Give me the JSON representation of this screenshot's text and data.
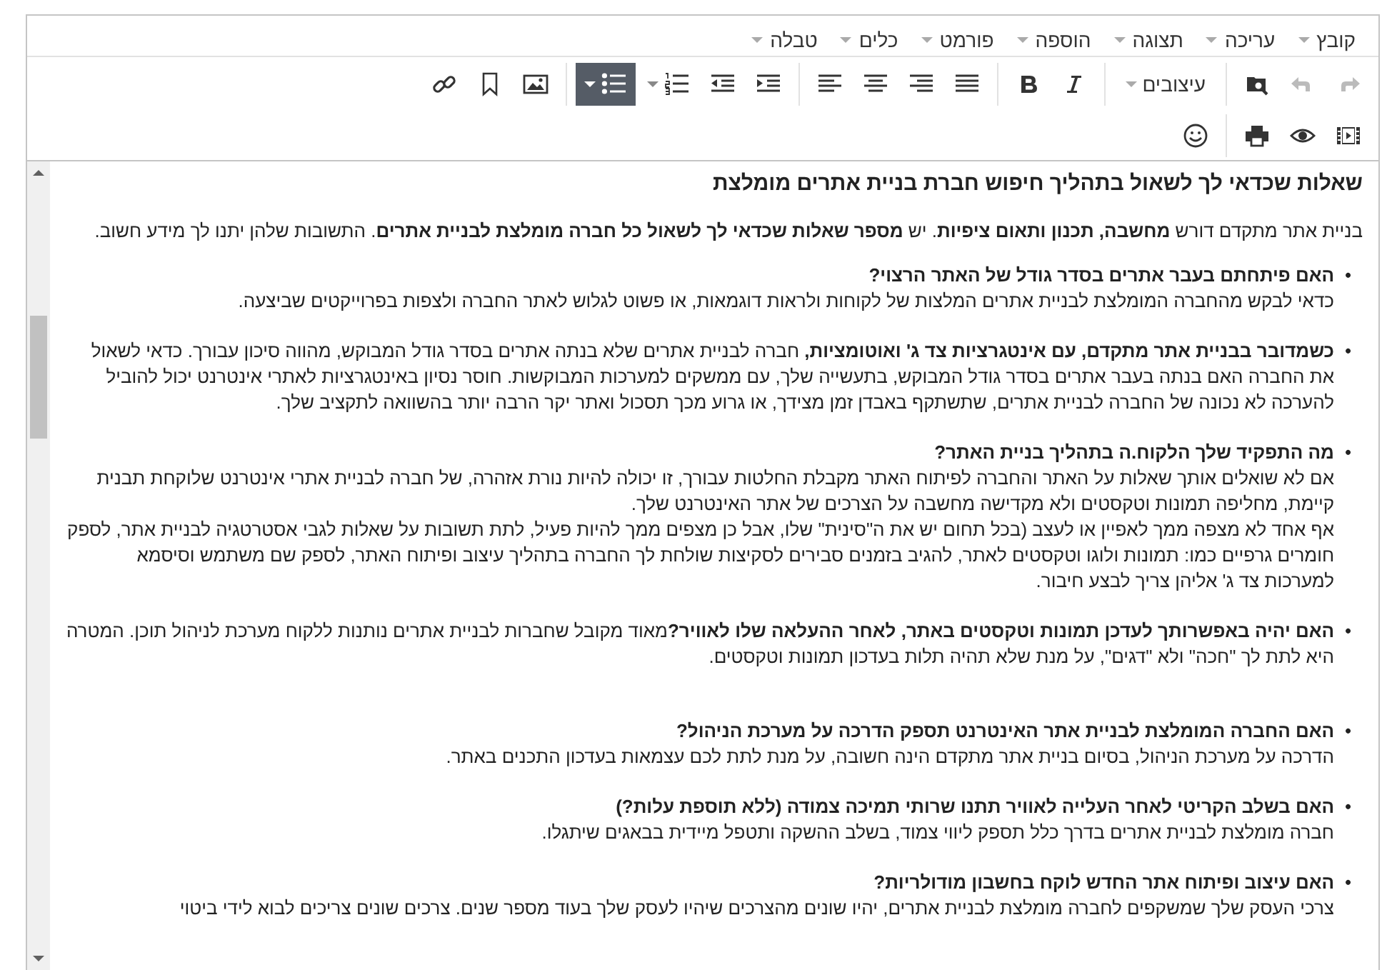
{
  "menubar": [
    {
      "label": "קובץ"
    },
    {
      "label": "עריכה"
    },
    {
      "label": "תצוגה"
    },
    {
      "label": "הוספה"
    },
    {
      "label": "פורמט"
    },
    {
      "label": "כלים"
    },
    {
      "label": "טבלה"
    }
  ],
  "toolbar": {
    "redo": {
      "disabled": true
    },
    "undo": {
      "disabled": true
    },
    "styles": {
      "label": "עיצובים"
    },
    "numbered_list": {
      "selected": false
    },
    "bullet_list": {
      "selected": true
    }
  },
  "document": {
    "heading": "שאלות שכדאי לך לשאול בתהליך חיפוש חברת בניית  אתרים מומלצת",
    "intro": "בניית אתר מתקדם דורש **מחשבה, תכנון ותאום ציפיות**. יש **מספר שאלות שכדאי לך לשאול כל חברה מומלצת לבניית אתרים**. התשובות שלהן יתנו לך מידע חשוב.",
    "bullet": "•",
    "items": [
      {
        "kind": "block",
        "question": "האם פיתחתם בעבר אתרים בסדר גודל של האתר הרצוי?",
        "answer": [
          "כדאי לבקש מהחברה המומלצת לבניית אתרים המלצות של לקוחות ולראות דוגמאות, או פשוט לגלוש לאתר החברה ולצפות בפרוייקטים שביצעה."
        ]
      },
      {
        "kind": "inline",
        "question": "כשמדובר בבניית אתר מתקדם, עם אינטגרציות צד ג' ואוטומציות,",
        "answer": [
          " חברה לבניית אתרים שלא בנתה אתרים בסדר גודל המבוקש, מהווה סיכון עבורך. כדאי לשאול את החברה האם בנתה בעבר אתרים בסדר גודל המבוקש, בתעשייה שלך, עם ממשקים למערכות המבוקשות. חוסר נסיון באינטגרציות לאתרי אינטרנט יכול להוביל להערכה לא נכונה של החברה לבניית אתרים, שתשתקף באבדן זמן מצידך, או גרוע מכך תסכול ואתר יקר הרבה יותר בהשוואה לתקציב שלך."
        ]
      },
      {
        "kind": "block",
        "question": "מה התפקיד שלך הלקוח.ה בתהליך בניית האתר?",
        "answer": [
          "אם לא שואלים אותך שאלות על האתר והחברה לפיתוח האתר מקבלת החלטות עבורך, זו יכולה להיות נורת אזהרה, של חברה לבניית אתרי אינטרנט שלוקחת תבנית קיימת, מחליפה תמונות וטקסטים ולא מקדישה מחשבה על הצרכים של אתר האינטרנט שלך.",
          "אף אחד לא מצפה ממך לאפיין או לעצב (בכל תחום יש את ה\"סינית\" שלו, אבל כן מצפים ממך להיות פעיל, לתת תשובות על שאלות לגבי אסטרטגיה לבניית אתר, לספק חומרים גרפיים כמו: תמונות ולוגו וטקסטים לאתר, להגיב בזמנים סבירים לסקיצות שולחת לך החברה בתהליך עיצוב ופיתוח האתר, לספק שם משתמש וסיסמא למערכות צד ג' אליהן צריך לבצע חיבור."
        ]
      },
      {
        "kind": "inline",
        "question": "האם יהיה באפשרותך לעדכן תמונות וטקסטים באתר, לאחר ההעלאה שלו לאוויר?",
        "answer": [
          "מאוד מקובל שחברות לבניית אתרים נותנות ללקוח מערכת לניהול תוכן. המטרה היא לתת לך \"חכה\" ולא \"דגים\", על מנת שלא תהיה תלות בעדכון תמונות וטקסטים."
        ]
      },
      {
        "kind": "block",
        "question": "האם החברה המומלצת לבניית אתר האינטרנט תספק הדרכה על מערכת הניהול?",
        "answer": [
          "הדרכה על מערכת הניהול, בסיום בניית אתר מתקדם הינה חשובה, על מנת לתת לכם עצמאות בעדכון התכנים באתר."
        ]
      },
      {
        "kind": "block",
        "question": "האם בשלב הקריטי לאחר העלייה לאוויר תתנו שרותי תמיכה צמודה (ללא תוספת עלות?)",
        "answer": [
          "חברה מומלצת לבניית אתרים בדרך כלל תספק ליווי צמוד, בשלב ההשקה ותטפל מיידית בבאגים שיתגלו."
        ]
      },
      {
        "kind": "block",
        "question": "האם עיצוב ופיתוח אתר החדש לוקח בחשבון מודולריות?",
        "answer": [
          "צרכי העסק שלך שמשקפים לחברה מומלצת לבניית אתרים, יהיו שונים מהצרכים שיהיו לעסק שלך בעוד מספר שנים. צרכים שונים צריכים לבוא לידי ביטוי"
        ]
      }
    ]
  }
}
